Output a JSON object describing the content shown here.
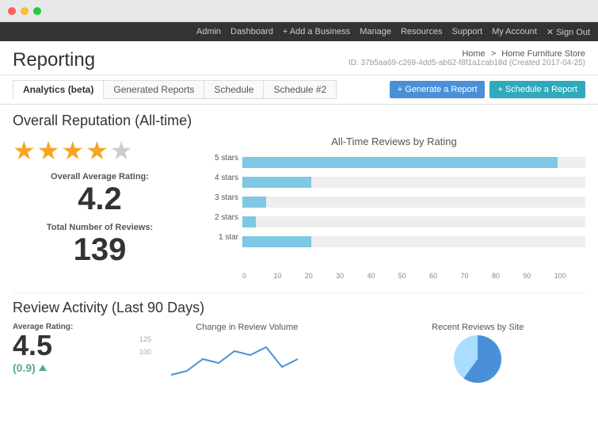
{
  "window": {
    "dots": [
      "red",
      "yellow",
      "green"
    ]
  },
  "topnav": {
    "items": [
      "Admin",
      "Dashboard",
      "+ Add a Business",
      "Manage",
      "Resources",
      "Support",
      "My Account",
      "✕ Sign Out"
    ]
  },
  "header": {
    "title": "Reporting",
    "breadcrumb": {
      "home": "Home",
      "separator": ">",
      "store": "Home Furniture Store"
    },
    "id_line": "ID: 37b5aa69-c269-4dd5-ab62-f8f1a1cab18d (Created 2017-04-25)"
  },
  "tabs": {
    "items": [
      {
        "label": "Analytics (beta)",
        "active": true
      },
      {
        "label": "Generated Reports",
        "active": false
      },
      {
        "label": "Schedule",
        "active": false
      },
      {
        "label": "Schedule #2",
        "active": false
      }
    ],
    "buttons": [
      {
        "label": "+ Generate a Report",
        "style": "blue"
      },
      {
        "label": "+ Schedule a Report",
        "style": "teal"
      }
    ]
  },
  "reputation": {
    "section_title": "Overall Reputation (All-time)",
    "stars": {
      "full": 4,
      "half": 1
    },
    "avg_rating_label": "Overall Average Rating:",
    "avg_rating_value": "4.2",
    "total_reviews_label": "Total Number of Reviews:",
    "total_reviews_value": "139"
  },
  "bar_chart": {
    "title": "All-Time Reviews by Rating",
    "bars": [
      {
        "label": "5 stars",
        "pct": 92,
        "value": 92
      },
      {
        "label": "4 stars",
        "pct": 20,
        "value": 20
      },
      {
        "label": "3 stars",
        "pct": 7,
        "value": 7
      },
      {
        "label": "2 stars",
        "pct": 4,
        "value": 4
      },
      {
        "label": "1 star",
        "pct": 20,
        "value": 20
      }
    ],
    "x_ticks": [
      "0",
      "10",
      "20",
      "30",
      "40",
      "50",
      "60",
      "70",
      "80",
      "90",
      "100"
    ],
    "max": 100
  },
  "activity": {
    "section_title": "Review Activity (Last 90 Days)",
    "avg_label": "Average Rating:",
    "avg_value": "4.5",
    "change_value": "(0.9)",
    "volume_title": "Change in Review Volume",
    "volume_y_labels": [
      "125",
      "100"
    ],
    "recent_title": "Recent Reviews by Site"
  }
}
